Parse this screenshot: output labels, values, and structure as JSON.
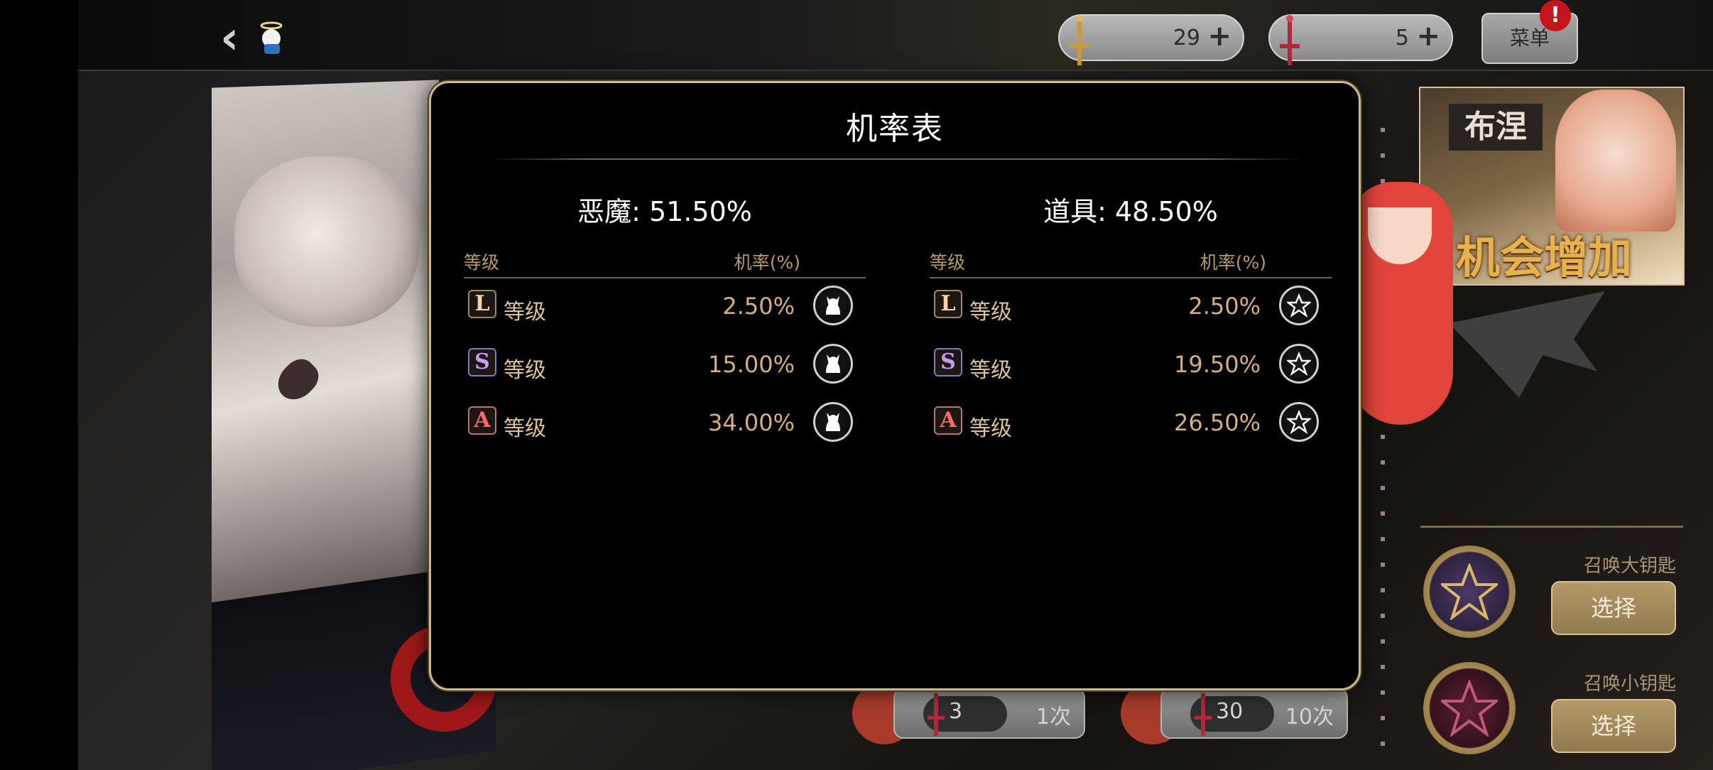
{
  "currencies": [
    {
      "value": "29",
      "plus": "+"
    },
    {
      "value": "5",
      "plus": "+"
    }
  ],
  "menu": {
    "label": "菜单",
    "badge": "!"
  },
  "banner": {
    "name": "布涅",
    "boost_text": "机会增加"
  },
  "summon": {
    "big_key": {
      "label": "召唤大钥匙",
      "button": "选择"
    },
    "small_key": {
      "label": "召唤小钥匙",
      "button": "选择"
    }
  },
  "draw_buttons": [
    {
      "count": "3",
      "times": "1次"
    },
    {
      "count": "30",
      "times": "10次"
    }
  ],
  "modal": {
    "title": "机率表",
    "demon": {
      "header": "恶魔: 51.50%",
      "col_grade": "等级",
      "col_rate": "机率(%)",
      "rows": [
        {
          "badge": "L",
          "label": "等级",
          "rate": "2.50%",
          "icon": "demon-cat-icon"
        },
        {
          "badge": "S",
          "label": "等级",
          "rate": "15.00%",
          "icon": "demon-cat-icon"
        },
        {
          "badge": "A",
          "label": "等级",
          "rate": "34.00%",
          "icon": "demon-cat-icon"
        }
      ]
    },
    "item": {
      "header": "道具: 48.50%",
      "col_grade": "等级",
      "col_rate": "机率(%)",
      "rows": [
        {
          "badge": "L",
          "label": "等级",
          "rate": "2.50%",
          "icon": "pentagram-icon"
        },
        {
          "badge": "S",
          "label": "等级",
          "rate": "19.50%",
          "icon": "pentagram-icon"
        },
        {
          "badge": "A",
          "label": "等级",
          "rate": "26.50%",
          "icon": "pentagram-icon"
        }
      ]
    }
  },
  "colors": {
    "modal_border": "#cdb98a",
    "rate_text": "#d3b07e",
    "grade_text": "#dcc296",
    "menu_badge": "#c4141c"
  }
}
